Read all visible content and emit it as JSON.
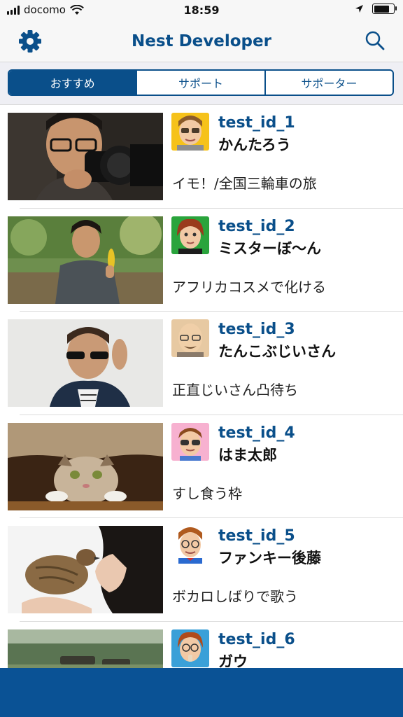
{
  "status_bar": {
    "carrier": "docomo",
    "time": "18:59",
    "signal_bars": 4,
    "battery_level": 0.9
  },
  "nav": {
    "title": "Nest Developer",
    "left_icon": "gear-icon",
    "right_icon": "search-icon"
  },
  "tabs": [
    {
      "label": "おすすめ",
      "active": true
    },
    {
      "label": "サポート",
      "active": false
    },
    {
      "label": "サポーター",
      "active": false
    }
  ],
  "items": [
    {
      "id": "test_id_1",
      "name": "かんたろう",
      "desc": "イモ！/全国三輪車の旅"
    },
    {
      "id": "test_id_2",
      "name": "ミスターぼ〜ん",
      "desc": "アフリカコスメで化ける"
    },
    {
      "id": "test_id_3",
      "name": "たんこぶじいさん",
      "desc": "正直じいさん凸待ち"
    },
    {
      "id": "test_id_4",
      "name": "はま太郎",
      "desc": "すし食う枠"
    },
    {
      "id": "test_id_5",
      "name": "ファンキー後藤",
      "desc": "ボカロしばりで歌う"
    },
    {
      "id": "test_id_6",
      "name": "ガウ",
      "desc": ""
    }
  ],
  "colors": {
    "brand": "#0a4f8a",
    "bottom_bar": "#0a5295"
  }
}
